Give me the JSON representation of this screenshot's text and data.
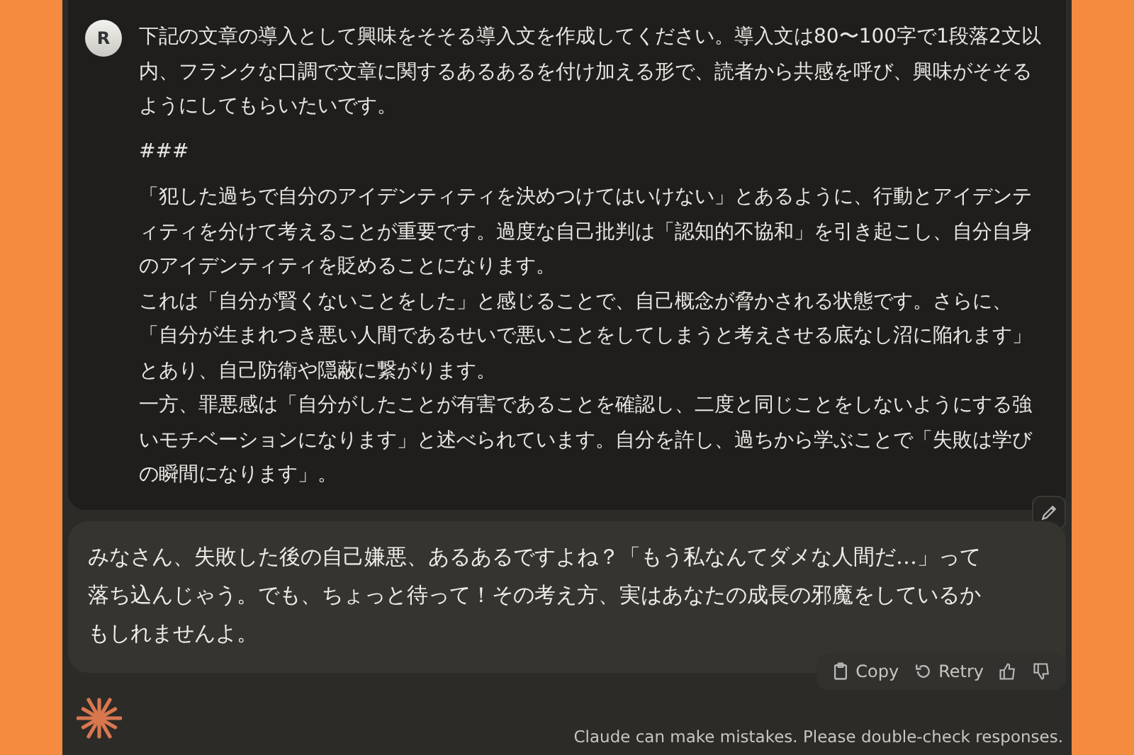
{
  "user_message": {
    "avatar": "R",
    "paragraphs": [
      "下記の文章の導入として興味をそそる導入文を作成してください。導入文は80〜100字で1段落2文以内、フランクな口調で文章に関するあるあるを付け加える形で、読者から共感を呼び、興味がそそるようにしてもらいたいです。",
      "###",
      "「犯した過ちで自分のアイデンティティを決めつけてはいけない」とあるように、行動とアイデンティティを分けて考えることが重要です。過度な自己批判は「認知的不協和」を引き起こし、自分自身のアイデンティティを貶めることになります。",
      "これは「自分が賢くないことをした」と感じることで、自己概念が脅かされる状態です。さらに、「自分が生まれつき悪い人間であるせいで悪いことをしてしまうと考えさせる底なし沼に陥れます」とあり、自己防衛や隠蔽に繋がります。",
      "一方、罪悪感は「自分がしたことが有害であることを確認し、二度と同じことをしないようにする強いモチベーションになります」と述べられています。自分を許し、過ちから学ぶことで「失敗は学びの瞬間になります」。"
    ]
  },
  "response": {
    "text": "みなさん、失敗した後の自己嫌悪、あるあるですよね？「もう私なんてダメな人間だ…」って落ち込んじゃう。でも、ちょっと待って！その考え方、実はあなたの成長の邪魔をしているかもしれませんよ。",
    "actions": [
      {
        "kind": "copy",
        "label": "Copy"
      },
      {
        "kind": "retry",
        "label": "Retry"
      },
      {
        "kind": "thumbs_up"
      },
      {
        "kind": "thumbs_down"
      }
    ]
  },
  "disclaimer": "Claude can make mistakes. Please double-check responses."
}
